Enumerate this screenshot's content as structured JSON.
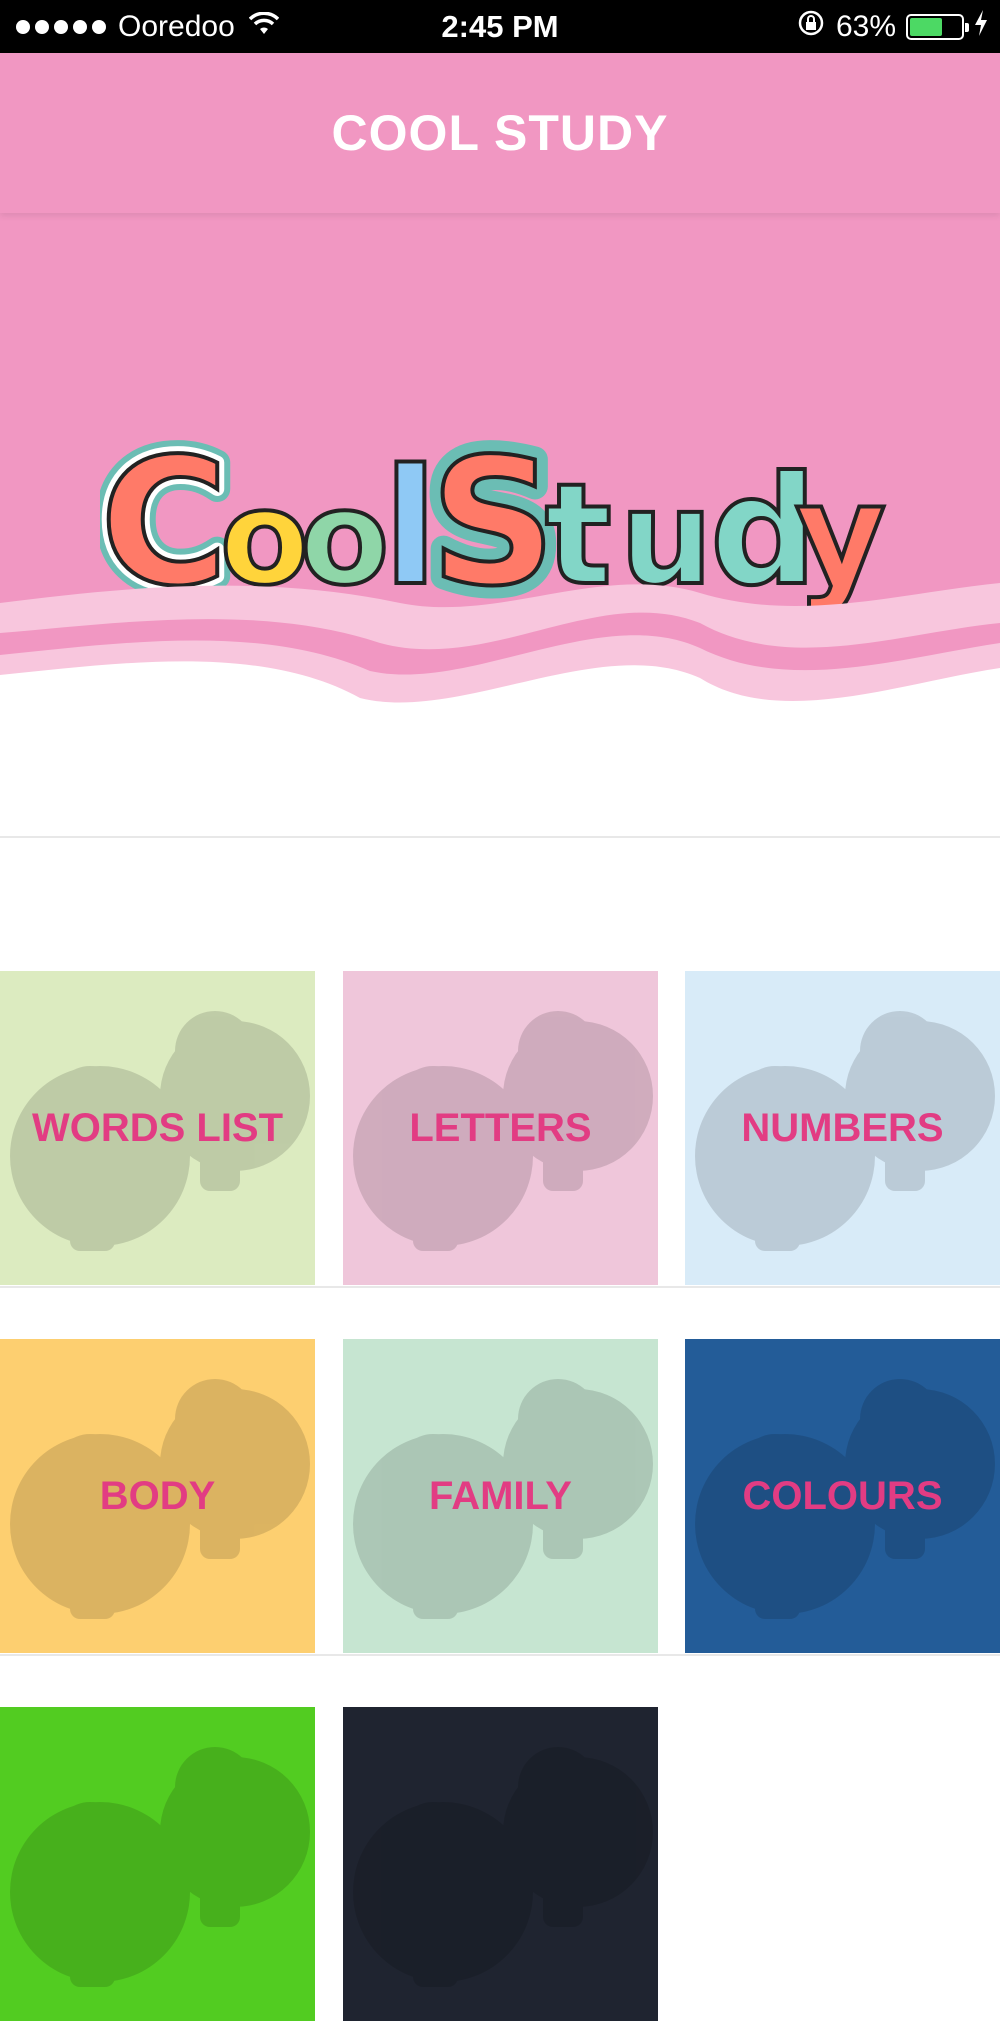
{
  "status_bar": {
    "carrier": "Ooredoo",
    "time": "2:45 PM",
    "battery_percent": "63%",
    "battery_level": 0.63
  },
  "header": {
    "title": "COOL STUDY"
  },
  "hero": {
    "logo_text_cool": "Cool",
    "logo_text_study": "Study"
  },
  "categories": [
    {
      "label": "WORDS LIST",
      "color": "#dcebc0"
    },
    {
      "label": "LETTERS",
      "color": "#efc6da"
    },
    {
      "label": "NUMBERS",
      "color": "#d8ebf8"
    },
    {
      "label": "BODY",
      "color": "#fdcf70"
    },
    {
      "label": "FAMILY",
      "color": "#c6e5d1"
    },
    {
      "label": "COLOURS",
      "color": "#235c98"
    },
    {
      "label": "",
      "color": "#52cc21"
    },
    {
      "label": "",
      "color": "#1f2430"
    }
  ],
  "colors": {
    "brand_pink": "#f197c2",
    "label_pink": "#e23c83"
  }
}
